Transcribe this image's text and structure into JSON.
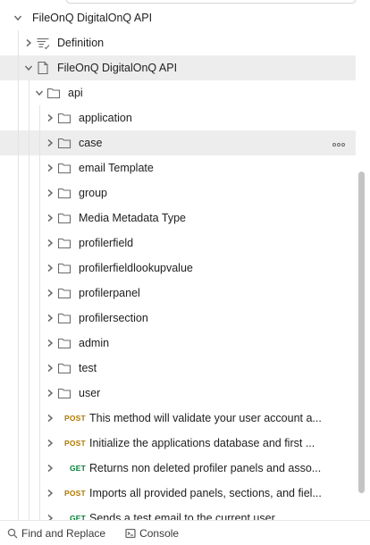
{
  "tree": {
    "rows": [
      {
        "label": "FileOnQ DigitalOnQ API",
        "kind": "collection",
        "depth": 0,
        "expanded": true
      },
      {
        "label": "Definition",
        "kind": "definition",
        "depth": 1,
        "expanded": false
      },
      {
        "label": "FileOnQ DigitalOnQ API",
        "kind": "document",
        "depth": 1,
        "expanded": true,
        "selected": true
      },
      {
        "label": "api",
        "kind": "folder",
        "depth": 2,
        "expanded": true
      },
      {
        "label": "application",
        "kind": "folder",
        "depth": 3,
        "expanded": false
      },
      {
        "label": "case",
        "kind": "folder",
        "depth": 3,
        "expanded": false,
        "hover": true,
        "more": "more-icon"
      },
      {
        "label": "email Template",
        "kind": "folder",
        "depth": 3,
        "expanded": false
      },
      {
        "label": "group",
        "kind": "folder",
        "depth": 3,
        "expanded": false
      },
      {
        "label": "Media Metadata Type",
        "kind": "folder",
        "depth": 3,
        "expanded": false
      },
      {
        "label": "profilerfield",
        "kind": "folder",
        "depth": 3,
        "expanded": false
      },
      {
        "label": "profilerfieldlookupvalue",
        "kind": "folder",
        "depth": 3,
        "expanded": false
      },
      {
        "label": "profilerpanel",
        "kind": "folder",
        "depth": 3,
        "expanded": false
      },
      {
        "label": "profilersection",
        "kind": "folder",
        "depth": 3,
        "expanded": false
      },
      {
        "label": "admin",
        "kind": "folder",
        "depth": 3,
        "expanded": false
      },
      {
        "label": "test",
        "kind": "folder",
        "depth": 3,
        "expanded": false
      },
      {
        "label": "user",
        "kind": "folder",
        "depth": 3,
        "expanded": false
      },
      {
        "label": "This method will validate your user account a...",
        "kind": "request",
        "method": "POST",
        "depth": 3
      },
      {
        "label": "Initialize the applications database and first ...",
        "kind": "request",
        "method": "POST",
        "depth": 3
      },
      {
        "label": "Returns non deleted profiler panels and asso...",
        "kind": "request",
        "method": "GET",
        "depth": 3
      },
      {
        "label": "Imports all provided panels, sections, and fiel...",
        "kind": "request",
        "method": "POST",
        "depth": 3
      },
      {
        "label": "Sends a test email to the current user",
        "kind": "request",
        "method": "GET",
        "depth": 3
      }
    ]
  },
  "footer": {
    "find_replace": "Find and Replace",
    "find_icon": "search-icon",
    "console": "Console",
    "console_icon": "terminal-icon"
  },
  "colors": {
    "post": "#ad7a03",
    "get": "#007f31",
    "selected_bg": "#ededed",
    "icon": "#6b6b6b"
  }
}
